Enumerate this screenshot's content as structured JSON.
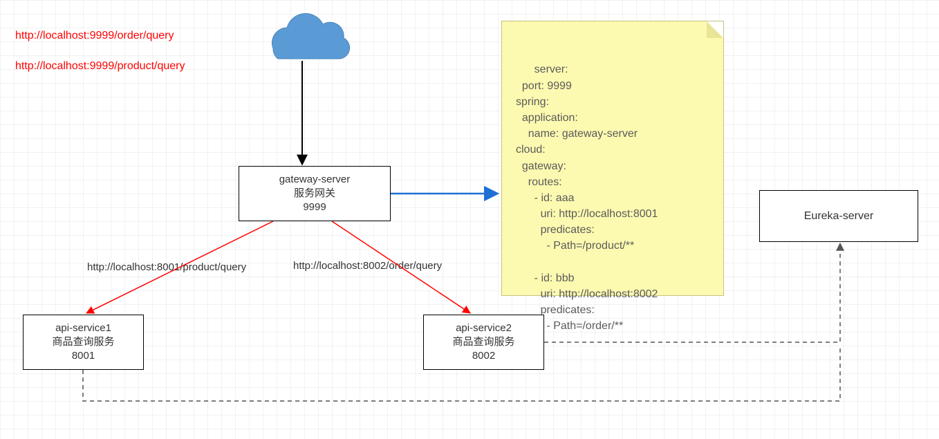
{
  "links": {
    "order_query": "http://localhost:9999/order/query",
    "product_query": "http://localhost:9999/product/query"
  },
  "nodes": {
    "gateway": {
      "line1": "gateway-server",
      "line2": "服务网关",
      "line3": "9999"
    },
    "api1": {
      "line1": "api-service1",
      "line2": "商品查询服务",
      "line3": "8001"
    },
    "api2": {
      "line1": "api-service2",
      "line2": "商品查询服务",
      "line3": "8002"
    },
    "eureka": {
      "line1": "Eureka-server"
    }
  },
  "edge_labels": {
    "to_api1": "http://localhost:8001/product/query",
    "to_api2": "http://localhost:8002/order/query"
  },
  "config_note": "server:\n  port: 9999\nspring:\n  application:\n    name: gateway-server\ncloud:\n  gateway:\n    routes:\n      - id: aaa\n        uri: http://localhost:8001\n        predicates:\n          - Path=/product/**\n\n      - id: bbb\n        uri: http://localhost:8002\n        predicates:\n          - Path=/order/**",
  "colors": {
    "cloud": "#5b9bd5",
    "red": "#ff0000",
    "blue_arrow": "#1f6fd4",
    "note_bg": "#fcfab0"
  }
}
